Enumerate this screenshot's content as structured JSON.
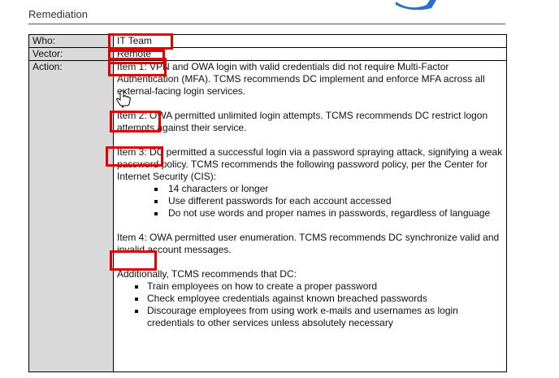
{
  "section_title": "Remediation",
  "rows": [
    {
      "label": "Who:",
      "value": "IT Team"
    },
    {
      "label": "Vector:",
      "value": "Remote"
    }
  ],
  "action": {
    "label": "Action:",
    "item1": "Item 1: VPN and OWA login with valid credentials did not require Multi-Factor Authentication (MFA).  TCMS recommends DC implement and enforce MFA across all external-facing login services.",
    "item2": "Item 2: OWA permitted unlimited login attempts.  TCMS recommends DC restrict logon attempts against their service.",
    "item3": "Item 3: DC permitted a successful login via a password spraying attack, signifying a weak password policy.  TCMS recommends the following password policy, per the Center for Internet Security (CIS):",
    "item3_bullets": [
      "14 characters or longer",
      "Use different passwords for each account accessed",
      "Do not use words and proper names in passwords, regardless of language"
    ],
    "item4": "Item 4: OWA permitted user enumeration.  TCMS recommends DC synchronize valid and invalid account messages.",
    "additional_intro": "Additionally, TCMS recommends that DC:",
    "additional_bullets": [
      "Train employees on how to create a proper password",
      "Check employee credentials against known breached passwords",
      "Discourage employees from using work e-mails and usernames as login credentials to other services unless absolutely necessary"
    ]
  },
  "colors": {
    "highlight": "#e00000",
    "label_bg": "#d9d9d9",
    "logo": "#2a6fc9"
  },
  "icons": {
    "cursor": "hand-pointer-icon",
    "logo": "brand-logo-icon"
  }
}
